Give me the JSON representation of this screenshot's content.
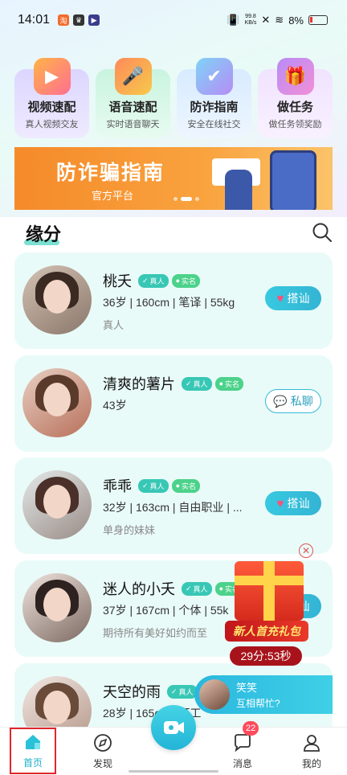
{
  "status_bar": {
    "time": "14:01",
    "net_speed": "99.8",
    "net_unit": "KB/s",
    "battery": "8%"
  },
  "quick_cards": [
    {
      "title": "视频速配",
      "subtitle": "真人视频交友",
      "icon": "tv-icon"
    },
    {
      "title": "语音速配",
      "subtitle": "实时语音聊天",
      "icon": "microphone-icon"
    },
    {
      "title": "防诈指南",
      "subtitle": "安全在线社交",
      "icon": "shield-icon"
    },
    {
      "title": "做任务",
      "subtitle": "做任务领奖励",
      "icon": "gift-box-icon"
    }
  ],
  "banner": {
    "title": "防诈骗指南",
    "subtitle": "官方平台"
  },
  "section": {
    "title": "缘分"
  },
  "badges": {
    "real": "真人",
    "verified": "实名"
  },
  "users": [
    {
      "name": "桃夭",
      "info": "36岁 | 160cm | 笔译 | 55kg",
      "desc": "真人",
      "action": "搭讪",
      "action_icon": "heart-icon",
      "style": "primary",
      "show_verified": true
    },
    {
      "name": "清爽的薯片",
      "info": "43岁",
      "desc": "",
      "action": "私聊",
      "action_icon": "chat-bubble-icon",
      "style": "outline",
      "show_verified": true
    },
    {
      "name": "乖乖",
      "info": "32岁 | 163cm | 自由职业 | ...",
      "desc": "单身的妹妹",
      "action": "搭讪",
      "action_icon": "heart-icon",
      "style": "primary",
      "show_verified": true
    },
    {
      "name": "迷人的小夭",
      "info": "37岁 | 167cm | 个体 | 55k",
      "desc": "期待所有美好如约而至",
      "action": "搭讪",
      "action_icon": "heart-icon",
      "style": "primary",
      "show_verified": true
    },
    {
      "name": "天空的雨",
      "info": "28岁 | 165cm | 打工",
      "desc": "",
      "action": "",
      "action_icon": "",
      "style": "primary",
      "show_verified": false
    }
  ],
  "gift_popup": {
    "label": "新人首充礼包",
    "timer": "29分:53秒"
  },
  "chat_popup": {
    "name": "笑笑",
    "message": "互相帮忙?"
  },
  "bottom_nav": {
    "items": [
      {
        "label": "首页",
        "icon": "home-icon"
      },
      {
        "label": "发现",
        "icon": "compass-icon"
      },
      {
        "label": "",
        "icon": "video-call-icon"
      },
      {
        "label": "消息",
        "icon": "message-icon",
        "badge": "22"
      },
      {
        "label": "我的",
        "icon": "person-icon"
      }
    ]
  }
}
